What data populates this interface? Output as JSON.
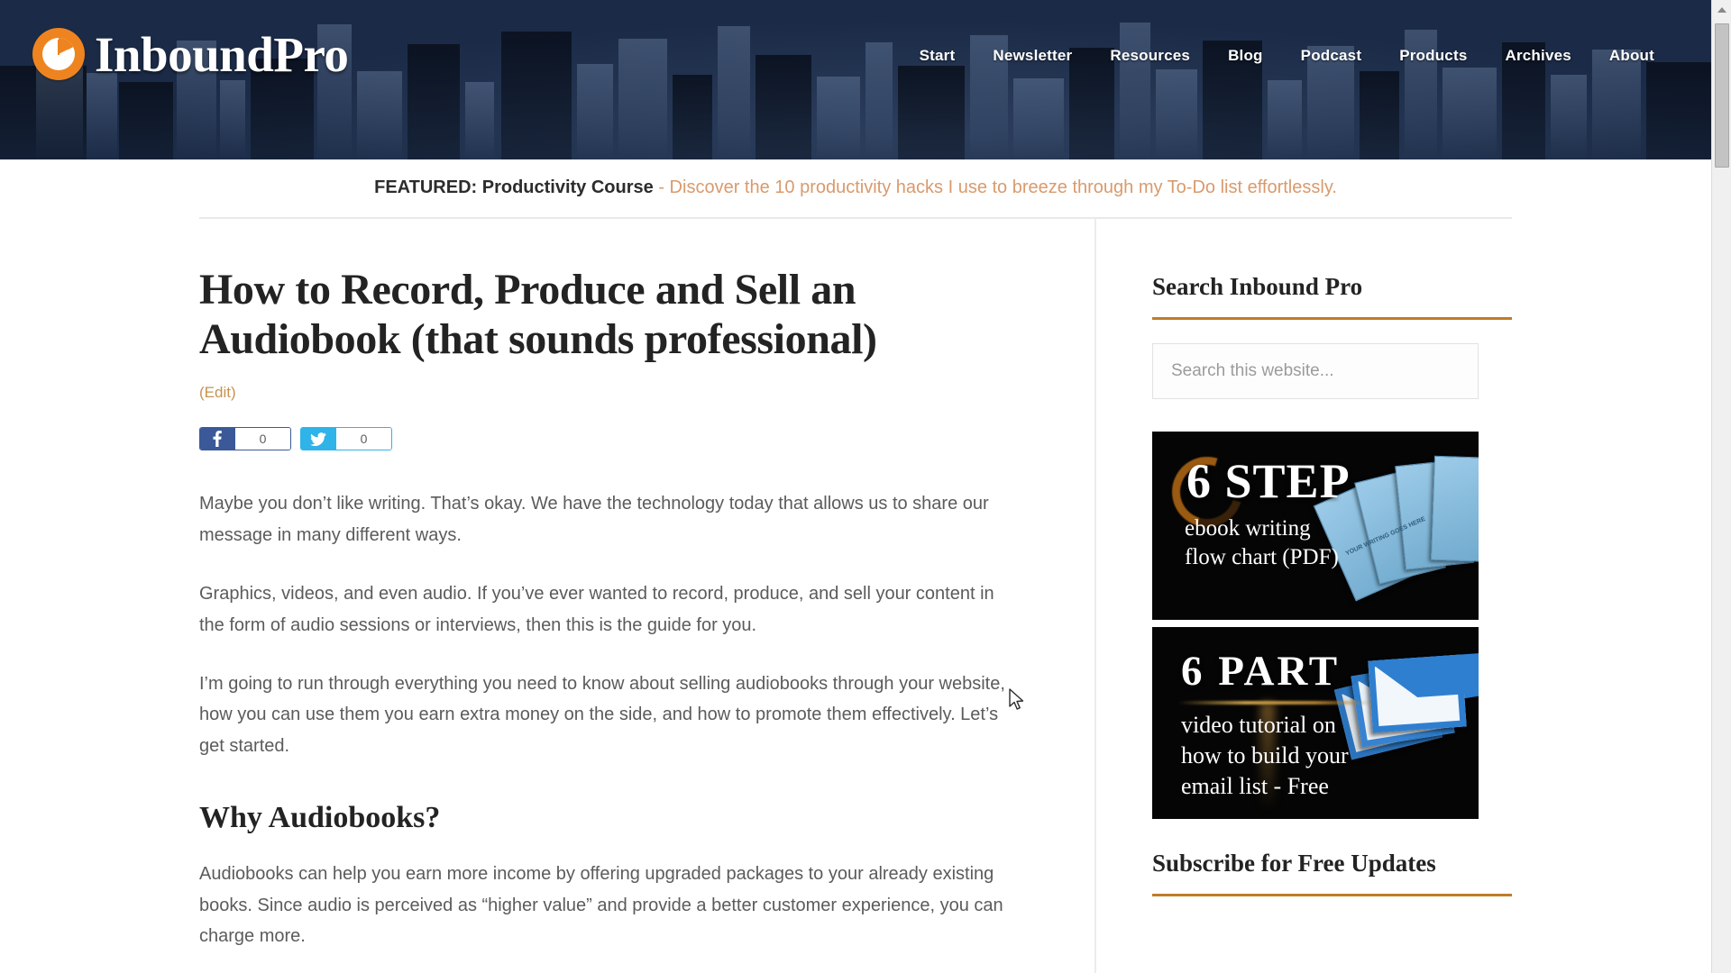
{
  "site": {
    "logo_text": "InboundPro",
    "logo_icon": "pie-chart-icon"
  },
  "nav": {
    "items": [
      {
        "label": "Start"
      },
      {
        "label": "Newsletter"
      },
      {
        "label": "Resources"
      },
      {
        "label": "Blog"
      },
      {
        "label": "Podcast"
      },
      {
        "label": "Products"
      },
      {
        "label": "Archives"
      },
      {
        "label": "About"
      }
    ]
  },
  "featured": {
    "label": "FEATURED: Productivity Course",
    "description": " - Discover the 10 productivity hacks I use to breeze through my To-Do list effortlessly.",
    "accent_color": "#d99a6c"
  },
  "post": {
    "title": "How to Record, Produce and Sell an Audiobook (that sounds professional)",
    "edit_link": "(Edit)",
    "share": {
      "facebook": {
        "icon": "facebook-icon",
        "count": "0",
        "color": "#3b5998"
      },
      "twitter": {
        "icon": "twitter-bird-icon",
        "count": "0",
        "color": "#2fb3e8"
      }
    },
    "paragraphs": [
      "Maybe you don’t like writing. That’s okay. We have the technology today that allows us to share our message in many different ways.",
      "Graphics, videos, and even audio. If you’ve ever wanted to record, produce, and sell your content in the form of audio sessions or interviews, then this is the guide for you.",
      "I’m going to run through everything you need to know about selling audiobooks through your website, how you can use them you earn extra money on the side, and how to promote them effectively. Let’s get started."
    ],
    "section_heading": "Why Audiobooks?",
    "section_paragraph": "Audiobooks can help you earn more income by offering upgraded packages to your already existing books. Since audio is perceived as “higher value” and provide a better customer experience, you can charge more."
  },
  "sidebar": {
    "search_widget": {
      "title": "Search Inbound Pro",
      "placeholder": "Search this website...",
      "value": ""
    },
    "banner_1": {
      "title": "6 STEP",
      "subtitle_line_1": "ebook writing",
      "subtitle_line_2": "flow chart (PDF)",
      "card_label": "YOUR WRITING GOES HERE",
      "background": "#050505",
      "accent": "#9a5a12"
    },
    "banner_2": {
      "title": "6  PART",
      "subtitle_line_1": "video tutorial on",
      "subtitle_line_2": "how to build your",
      "subtitle_line_3": "email list - Free",
      "background": "#050505",
      "accent": "#caa04a"
    },
    "subscribe_widget": {
      "title": "Subscribe for Free Updates"
    },
    "divider_color": "#c07c28"
  },
  "browser": {
    "scrollbar": {
      "position": "right",
      "arrow": "chevron-up-icon"
    },
    "cursor": "arrow-pointer"
  }
}
